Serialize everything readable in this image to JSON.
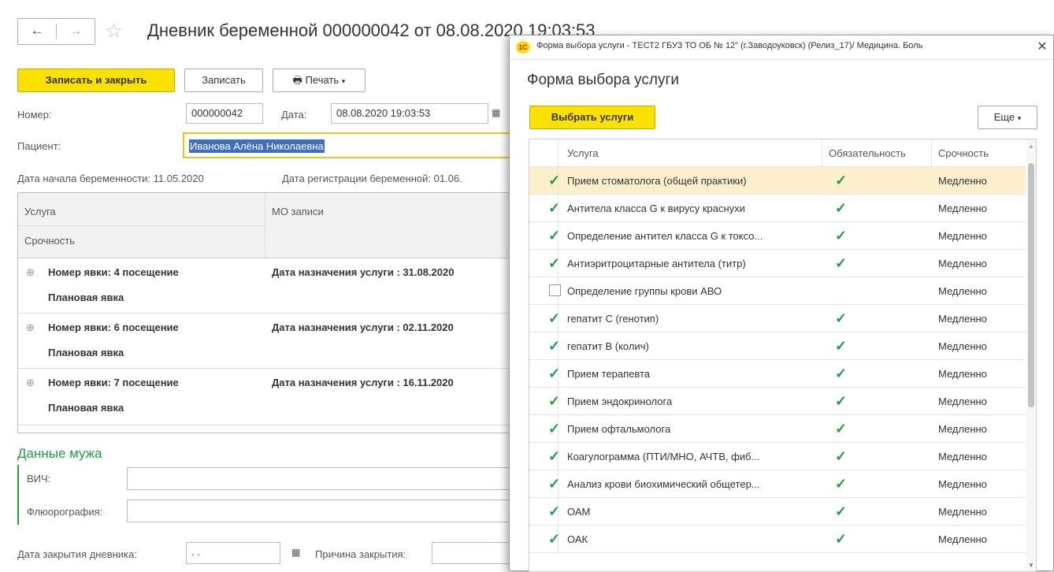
{
  "main": {
    "title": "Дневник беременной 000000042 от 08.08.2020 19:03:53",
    "toolbar": {
      "save_close_label": "Записать и закрыть",
      "save_label": "Записать",
      "print_label": "Печать"
    },
    "number_label": "Номер:",
    "number_value": "000000042",
    "date_label": "Дата:",
    "date_value": "08.08.2020 19:03:53",
    "patient_label": "Пациент:",
    "patient_value": "Иванова Алёна Николаевна",
    "pregnancy_start": "Дата начала беременности: 11.05.2020",
    "registration_date": "Дата регистрации беременной: 01.06.",
    "grid": {
      "col_service": "Услуга",
      "col_urgency": "Срочность",
      "col_mo": "МО записи",
      "groups": [
        {
          "visit": "Номер явки: 4 посещение",
          "date": "Дата назначения услуги : 31.08.2020",
          "type": "Плановая явка"
        },
        {
          "visit": "Номер явки: 6 посещение",
          "date": "Дата назначения услуги : 02.11.2020",
          "type": "Плановая явка"
        },
        {
          "visit": "Номер явки: 7 посещение",
          "date": "Дата назначения услуги : 16.11.2020",
          "type": "Плановая явка"
        }
      ]
    },
    "husband_section": "Данные мужа",
    "hiv_label": "ВИЧ:",
    "fluoro_label": "Флюорография:",
    "close_date_label": "Дата закрытия дневника:",
    "close_date_value": ". .",
    "close_reason_label": "Причина закрытия:"
  },
  "dialog": {
    "window_title": "Форма выбора услуги - ТЕСТ2 ГБУЗ ТО ОБ № 12\" (г.Заводоуковск) (Релиз_17)/ Медицина. Боль",
    "logo_text": "1С",
    "heading": "Форма выбора услуги",
    "select_button": "Выбрать услуги",
    "more_button": "Еще",
    "columns": {
      "service": "Услуга",
      "mandatory": "Обязательность",
      "urgency": "Срочность"
    },
    "rows": [
      {
        "checked": true,
        "name": "Прием стоматолога (общей практики)",
        "mandatory": true,
        "urgency": "Медленно"
      },
      {
        "checked": true,
        "name": "Антитела класса G к вирусу краснухи",
        "mandatory": true,
        "urgency": "Медленно"
      },
      {
        "checked": true,
        "name": "Определение антител класса G к токсо...",
        "mandatory": true,
        "urgency": "Медленно"
      },
      {
        "checked": true,
        "name": "Антиэритроцитарные антитела (титр)",
        "mandatory": true,
        "urgency": "Медленно"
      },
      {
        "checked": false,
        "name": "Определение группы крови АВО",
        "mandatory": false,
        "urgency": "Медленно"
      },
      {
        "checked": true,
        "name": "гепатит С (генотип)",
        "mandatory": true,
        "urgency": "Медленно"
      },
      {
        "checked": true,
        "name": "гепатит В (колич)",
        "mandatory": true,
        "urgency": "Медленно"
      },
      {
        "checked": true,
        "name": "Прием терапевта",
        "mandatory": true,
        "urgency": "Медленно"
      },
      {
        "checked": true,
        "name": "Прием эндокринолога",
        "mandatory": true,
        "urgency": "Медленно"
      },
      {
        "checked": true,
        "name": "Прием офтальмолога",
        "mandatory": true,
        "urgency": "Медленно"
      },
      {
        "checked": true,
        "name": "Коагулограмма (ПТИ/МНО, АЧТВ, фиб...",
        "mandatory": true,
        "urgency": "Медленно"
      },
      {
        "checked": true,
        "name": "Анализ крови биохимический общетер...",
        "mandatory": true,
        "urgency": "Медленно"
      },
      {
        "checked": true,
        "name": "ОАМ",
        "mandatory": true,
        "urgency": "Медленно"
      },
      {
        "checked": true,
        "name": "ОАК",
        "mandatory": true,
        "urgency": "Медленно"
      }
    ]
  },
  "colors": {
    "accent_yellow": "#fbe100",
    "check_green": "#1e9e3e",
    "selected_row": "#fbefcc"
  }
}
